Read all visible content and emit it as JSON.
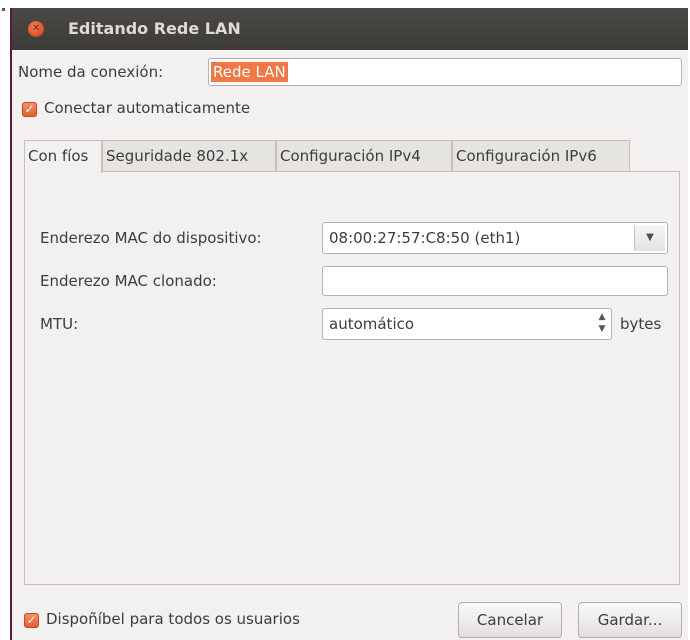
{
  "window": {
    "title": "Editando Rede LAN",
    "accent_color": "#e0532a"
  },
  "connection": {
    "name_label": "Nome da conexión:",
    "name_value": "Rede LAN",
    "autoconnect_label": "Conectar automaticamente",
    "autoconnect_checked": true
  },
  "tabs": [
    {
      "label": "Con fíos",
      "active": true
    },
    {
      "label": "Seguridade 802.1x",
      "active": false
    },
    {
      "label": "Configuración IPv4",
      "active": false
    },
    {
      "label": "Configuración IPv6",
      "active": false
    }
  ],
  "wired": {
    "mac_label": "Enderezo MAC do dispositivo:",
    "mac_value": "08:00:27:57:C8:50 (eth1)",
    "cloned_mac_label": "Enderezo MAC clonado:",
    "cloned_mac_value": "",
    "mtu_label": "MTU:",
    "mtu_value": "automático",
    "mtu_unit": "bytes"
  },
  "footer": {
    "all_users_label": "Dispoñíbel para todos os usuarios",
    "all_users_checked": true,
    "cancel_label": "Cancelar",
    "save_label": "Gardar..."
  },
  "icons": {
    "close": "close-icon",
    "check": "check-icon",
    "dropdown": "chevron-down-icon",
    "spin": "spin-arrows-icon"
  }
}
